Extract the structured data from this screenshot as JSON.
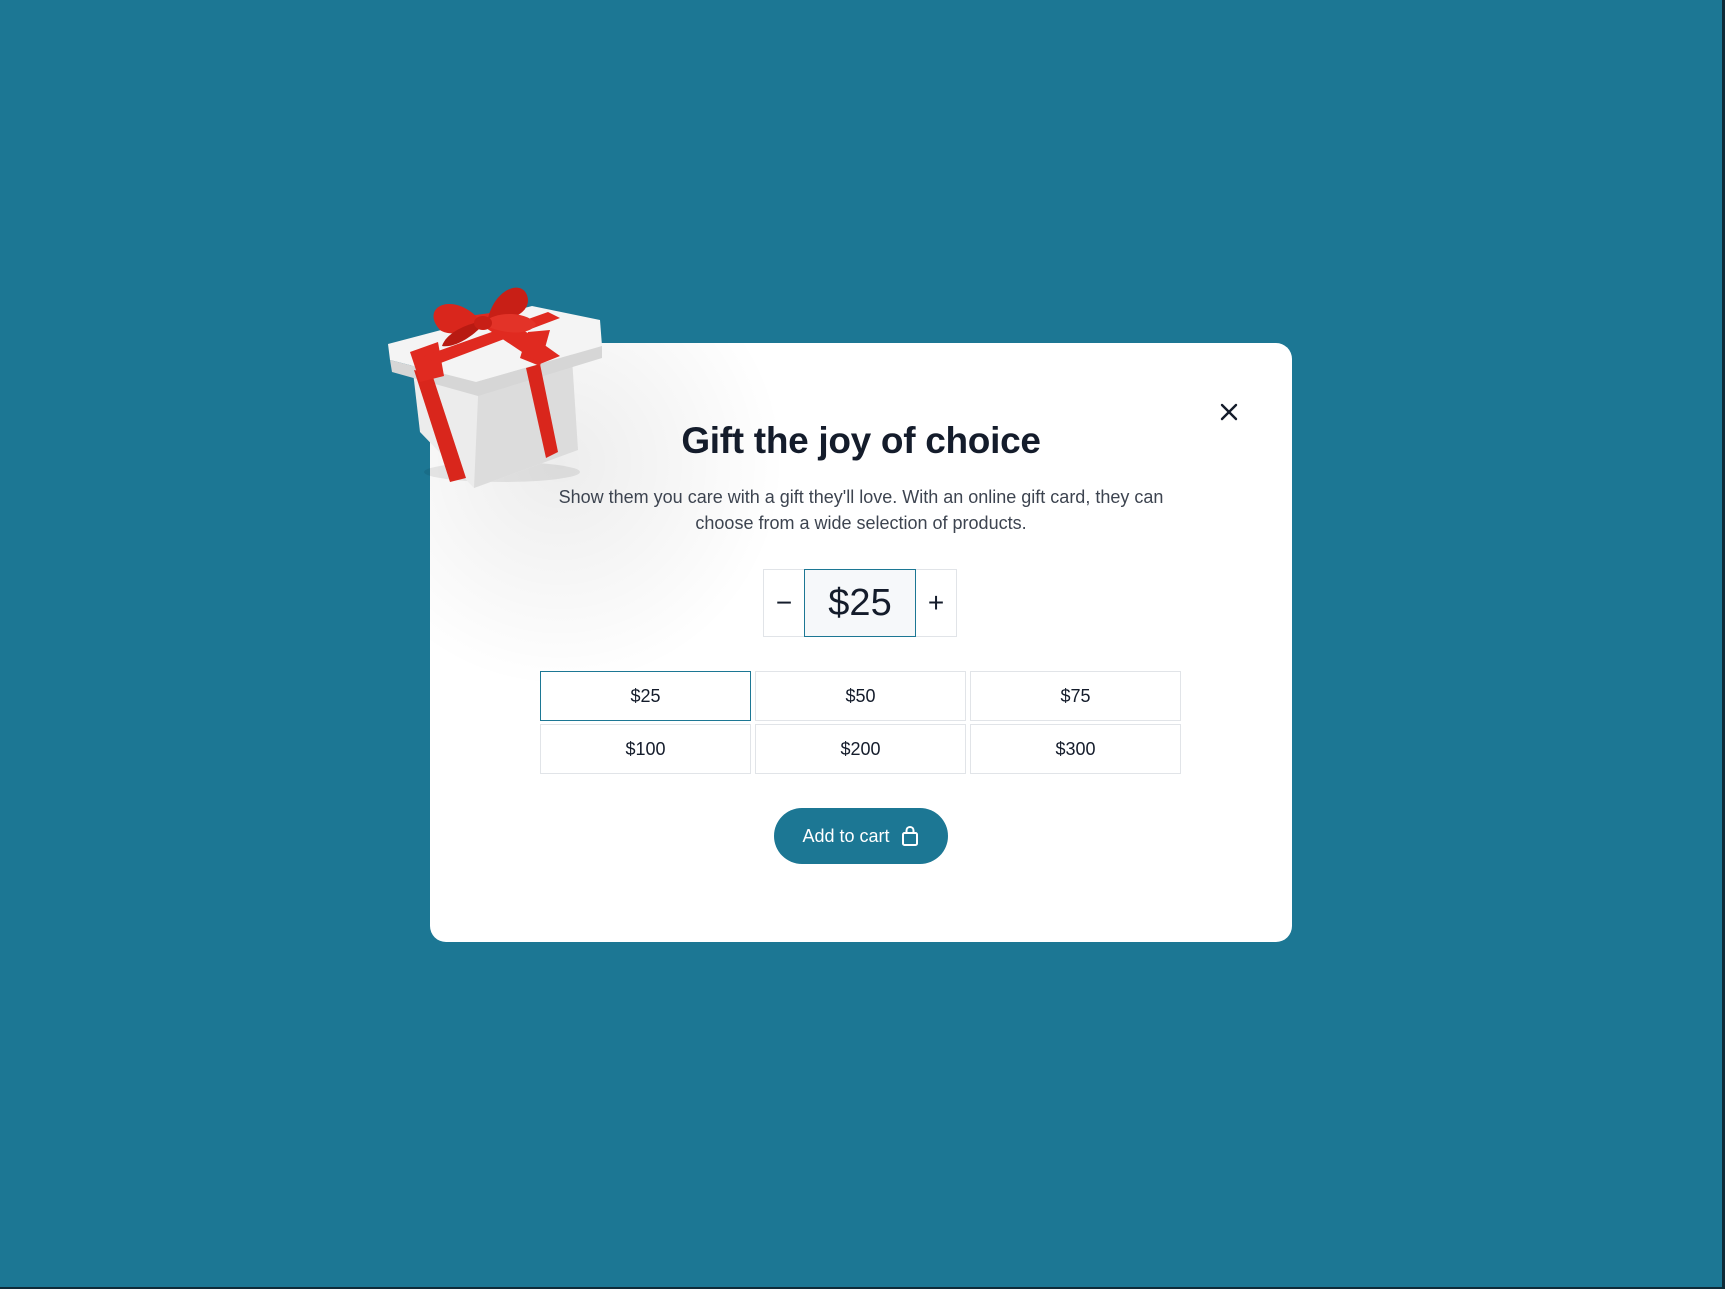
{
  "modal": {
    "title": "Gift the joy of choice",
    "subtitle": "Show them you care with a gift they'll love. With an online gift card, they can choose from a wide selection of products.",
    "close_icon": "close-icon",
    "gift_image": "gift-box-illustration"
  },
  "stepper": {
    "decrement_label": "−",
    "value": "$25",
    "increment_label": "+"
  },
  "amounts": [
    "$25",
    "$50",
    "$75",
    "$100",
    "$200",
    "$300"
  ],
  "selected_amount": "$25",
  "cart": {
    "label": "Add to cart",
    "icon": "shopping-bag-icon"
  },
  "colors": {
    "background": "#1c7794",
    "accent": "#1c7794",
    "ribbon": "#d9261c",
    "text": "#141c2b"
  }
}
